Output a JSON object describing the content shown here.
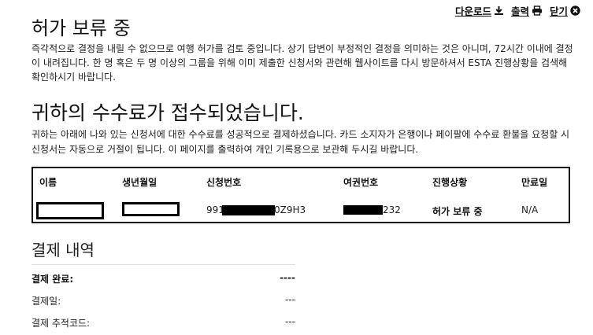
{
  "toolbar": {
    "download": "다운로드",
    "print": "출력",
    "close": "닫기"
  },
  "status_title": "허가 보류 중",
  "status_text": "즉각적으로 결정을 내릴 수 없으므로 여행 허가를 검토 중입니다. 상기 답변이 부정적인 결정을 의미하는 것은 아니며, 72시간 이내에 결정이 내려집니다. 한 명 혹은 두 명 이상의 그룹을 위해 이미 제출한 신청서와 관련해 웹사이트를 다시 방문하셔서 ESTA 진행상황을 검색해 확인하시기 바랍니다.",
  "fee_title": "귀하의 수수료가 접수되었습니다.",
  "fee_text": "귀하는 아래에 나와 있는 신청서에 대한 수수료를 성공적으로 결제하셨습니다. 카드 소지자가 은행이나 페이팔에 수수료 환불을 요청할 시 신청서는 자동으로 거절이 됩니다. 이 페이지를 출력하여 개인 기록용으로 보관해 두시길 바랍니다.",
  "applications": {
    "headers": {
      "name": "이름",
      "dob": "생년월일",
      "app_number": "신청번호",
      "passport": "여권번호",
      "status": "진행상황",
      "expiry": "만료일"
    },
    "row": {
      "app_number_prefix": "991",
      "app_number_suffix": "0Z9H3",
      "passport_suffix": "232",
      "status": "허가 보류 중",
      "expiry": "N/A"
    }
  },
  "payment": {
    "title": "결제 내역",
    "rows": [
      {
        "label": "결제 완료:",
        "value": "----"
      },
      {
        "label": "결제일:",
        "value": "---"
      },
      {
        "label": "결제 추적코드:",
        "value": "---"
      }
    ]
  },
  "colors": {
    "text": "#222222",
    "border": "#111111",
    "redaction": "#000000"
  }
}
